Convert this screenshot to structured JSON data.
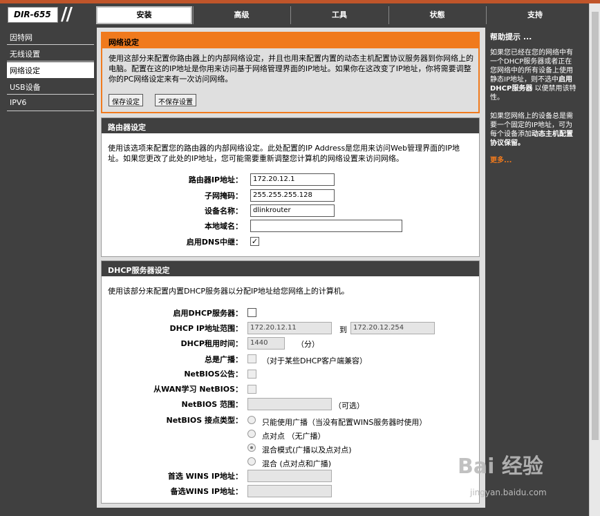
{
  "header": {
    "model": "DIR-655",
    "tabs": [
      "安装",
      "高级",
      "工具",
      "状態",
      "支持"
    ],
    "active_tab": "安装"
  },
  "sidebar": {
    "items": [
      {
        "label": "因特网"
      },
      {
        "label": "无线设置"
      },
      {
        "label": "网络设定"
      },
      {
        "label": "USB设备"
      },
      {
        "label": "IPV6"
      }
    ],
    "active": "网络设定"
  },
  "notice": {
    "title": "网络设定",
    "description": "使用这部分来配置你路由器上的内部网络设定，并且也用来配置内置的动态主机配置协议服务器到你网络上的电脑。配置在这的IP地址是你用来访问基于网络管理界面的IP地址。如果你在这改变了IP地址，你将需要调整你的PC网络设定来有一次访问网络。",
    "save_label": "保存设定",
    "nosave_label": "不保存设置"
  },
  "router": {
    "title": "路由器设定",
    "description": "使用该选项来配置您的路由器的内部网络设定。此处配置的IP Address是您用来访问Web管理界面的IP地址。如果您更改了此处的IP地址，您可能需要重新调整您计算机的网络设置来访问网络。",
    "ip_label": "路由器IP地址：",
    "ip_value": "172.20.12.1",
    "mask_label": "子网掩码：",
    "mask_value": "255.255.255.128",
    "device_label": "设备名称：",
    "device_value": "dlinkrouter",
    "domain_label": "本地域名：",
    "domain_value": "",
    "dns_label": "启用DNS中继：",
    "dns_checked": true
  },
  "dhcp": {
    "title": "DHCP服务器设定",
    "description": "使用该部分来配置内置DHCP服务器以分配IP地址给您网络上的计算机。",
    "enable_label": "启用DHCP服务器：",
    "range_label": "DHCP IP地址范围：",
    "range_start": "172.20.12.11",
    "range_to": "到",
    "range_end": "172.20.12.254",
    "lease_label": "DHCP租用时间：",
    "lease_value": "1440",
    "lease_unit": "（分）",
    "broadcast_label": "总是广播：",
    "broadcast_note": "（对于某些DHCP客户端兼容）",
    "netbios_label": "NetBIOS公告：",
    "wan_netbios_label": "从WAN学习 NetBIOS：",
    "netbios_scope_label": "NetBIOS 范围：",
    "netbios_scope_note": "（可选）",
    "node_type_label": "NetBIOS 接点类型：",
    "node_options": [
      "只能使用广播（当没有配置WINS服务器时使用）",
      "点对点 （无广播）",
      "混合模式(广播以及点对点)",
      "混合 (点对点和广播)"
    ],
    "node_selected": 2,
    "wins_primary_label": "首选 WINS IP地址：",
    "wins_secondary_label": "备选WINS IP地址："
  },
  "help": {
    "title": "帮助提示 ...",
    "para1_a": "如果您已经在您的网络中有一个DHCP服务器或者正在您网络中的所有设备上使用静态IP地址，则不选中",
    "para1_bold": "启用DHCP服务器",
    "para1_b": " 以便禁用该特性。",
    "para2_a": "如果您网络上的设备总是需要一个固定的IP地址，可为每个设备添加",
    "para2_bold": "动态主机配置协议保留。",
    "more": "更多..."
  },
  "watermark": {
    "brand": "Bai 经验",
    "url": "jingyan.baidu.com"
  }
}
